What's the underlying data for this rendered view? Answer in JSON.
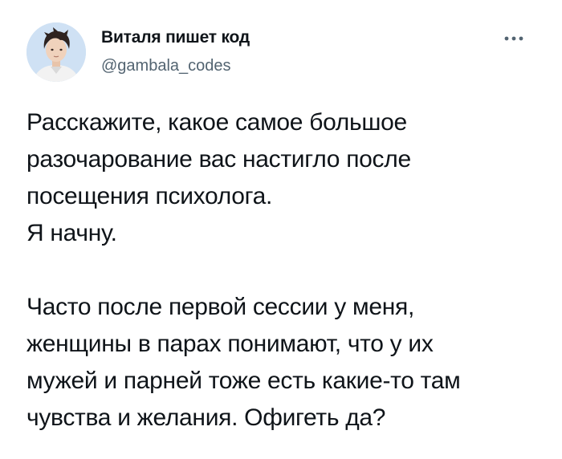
{
  "post": {
    "author": {
      "name": "Виталя пишет код",
      "handle": "@gambala_codes"
    },
    "more_icon": "more-horizontal-icon",
    "paragraphs": [
      {
        "lines": [
          "Расскажите, какое самое большое",
          "разочарование вас настигло после",
          "посещения психолога.",
          "Я начну."
        ]
      },
      {
        "lines": [
          "Часто после первой сессии у меня,",
          "женщины в парах понимают, что у их",
          "мужей и парней тоже есть какие-то там",
          "чувства и желания. Офигеть да?"
        ]
      }
    ]
  },
  "colors": {
    "text_primary": "#0f1419",
    "text_secondary": "#536471",
    "background": "#ffffff",
    "avatar_background": "#cfe1f4"
  }
}
